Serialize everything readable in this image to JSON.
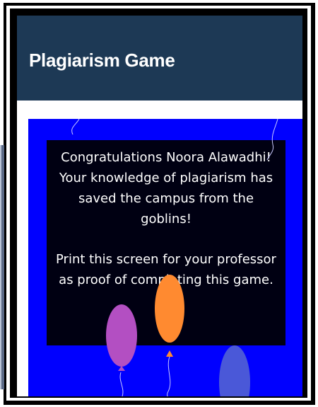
{
  "app": {
    "title": "Plagiarism Game"
  },
  "congrats": {
    "line1": "Congratulations Noora Alawadhi!",
    "line2": "Your knowledge of plagiarism has",
    "line3": "saved the campus from the",
    "line4": "goblins!",
    "line5": "Print this screen for your professor",
    "line6": "as proof of completing this game."
  },
  "colors": {
    "header": "#1d3955",
    "game_background": "#0000ff",
    "balloon_purple": "#b34fc2",
    "balloon_orange": "#ff8a30",
    "balloon_blue": "#4a58d8"
  }
}
